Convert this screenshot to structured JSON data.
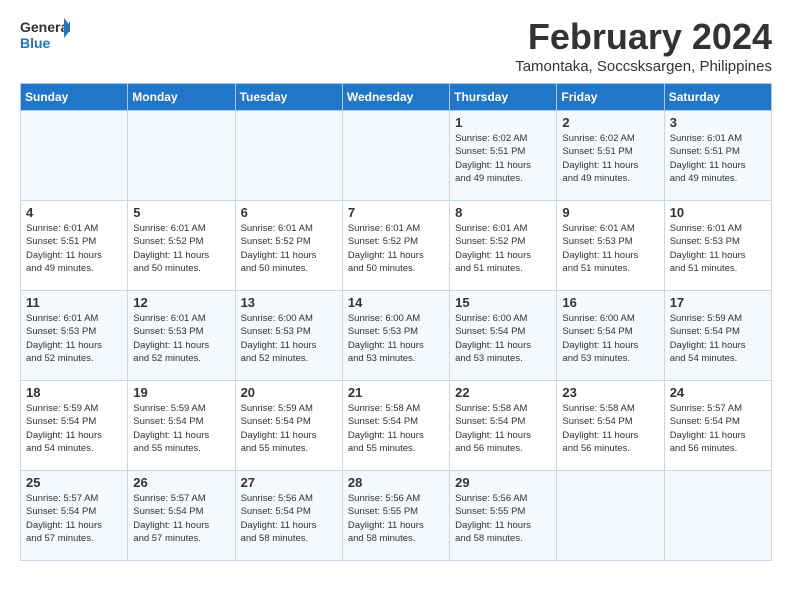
{
  "logo": {
    "text_general": "General",
    "text_blue": "Blue"
  },
  "header": {
    "month_year": "February 2024",
    "location": "Tamontaka, Soccsksargen, Philippines"
  },
  "days_of_week": [
    "Sunday",
    "Monday",
    "Tuesday",
    "Wednesday",
    "Thursday",
    "Friday",
    "Saturday"
  ],
  "weeks": [
    [
      {
        "day": "",
        "info": ""
      },
      {
        "day": "",
        "info": ""
      },
      {
        "day": "",
        "info": ""
      },
      {
        "day": "",
        "info": ""
      },
      {
        "day": "1",
        "info": "Sunrise: 6:02 AM\nSunset: 5:51 PM\nDaylight: 11 hours\nand 49 minutes."
      },
      {
        "day": "2",
        "info": "Sunrise: 6:02 AM\nSunset: 5:51 PM\nDaylight: 11 hours\nand 49 minutes."
      },
      {
        "day": "3",
        "info": "Sunrise: 6:01 AM\nSunset: 5:51 PM\nDaylight: 11 hours\nand 49 minutes."
      }
    ],
    [
      {
        "day": "4",
        "info": "Sunrise: 6:01 AM\nSunset: 5:51 PM\nDaylight: 11 hours\nand 49 minutes."
      },
      {
        "day": "5",
        "info": "Sunrise: 6:01 AM\nSunset: 5:52 PM\nDaylight: 11 hours\nand 50 minutes."
      },
      {
        "day": "6",
        "info": "Sunrise: 6:01 AM\nSunset: 5:52 PM\nDaylight: 11 hours\nand 50 minutes."
      },
      {
        "day": "7",
        "info": "Sunrise: 6:01 AM\nSunset: 5:52 PM\nDaylight: 11 hours\nand 50 minutes."
      },
      {
        "day": "8",
        "info": "Sunrise: 6:01 AM\nSunset: 5:52 PM\nDaylight: 11 hours\nand 51 minutes."
      },
      {
        "day": "9",
        "info": "Sunrise: 6:01 AM\nSunset: 5:53 PM\nDaylight: 11 hours\nand 51 minutes."
      },
      {
        "day": "10",
        "info": "Sunrise: 6:01 AM\nSunset: 5:53 PM\nDaylight: 11 hours\nand 51 minutes."
      }
    ],
    [
      {
        "day": "11",
        "info": "Sunrise: 6:01 AM\nSunset: 5:53 PM\nDaylight: 11 hours\nand 52 minutes."
      },
      {
        "day": "12",
        "info": "Sunrise: 6:01 AM\nSunset: 5:53 PM\nDaylight: 11 hours\nand 52 minutes."
      },
      {
        "day": "13",
        "info": "Sunrise: 6:00 AM\nSunset: 5:53 PM\nDaylight: 11 hours\nand 52 minutes."
      },
      {
        "day": "14",
        "info": "Sunrise: 6:00 AM\nSunset: 5:53 PM\nDaylight: 11 hours\nand 53 minutes."
      },
      {
        "day": "15",
        "info": "Sunrise: 6:00 AM\nSunset: 5:54 PM\nDaylight: 11 hours\nand 53 minutes."
      },
      {
        "day": "16",
        "info": "Sunrise: 6:00 AM\nSunset: 5:54 PM\nDaylight: 11 hours\nand 53 minutes."
      },
      {
        "day": "17",
        "info": "Sunrise: 5:59 AM\nSunset: 5:54 PM\nDaylight: 11 hours\nand 54 minutes."
      }
    ],
    [
      {
        "day": "18",
        "info": "Sunrise: 5:59 AM\nSunset: 5:54 PM\nDaylight: 11 hours\nand 54 minutes."
      },
      {
        "day": "19",
        "info": "Sunrise: 5:59 AM\nSunset: 5:54 PM\nDaylight: 11 hours\nand 55 minutes."
      },
      {
        "day": "20",
        "info": "Sunrise: 5:59 AM\nSunset: 5:54 PM\nDaylight: 11 hours\nand 55 minutes."
      },
      {
        "day": "21",
        "info": "Sunrise: 5:58 AM\nSunset: 5:54 PM\nDaylight: 11 hours\nand 55 minutes."
      },
      {
        "day": "22",
        "info": "Sunrise: 5:58 AM\nSunset: 5:54 PM\nDaylight: 11 hours\nand 56 minutes."
      },
      {
        "day": "23",
        "info": "Sunrise: 5:58 AM\nSunset: 5:54 PM\nDaylight: 11 hours\nand 56 minutes."
      },
      {
        "day": "24",
        "info": "Sunrise: 5:57 AM\nSunset: 5:54 PM\nDaylight: 11 hours\nand 56 minutes."
      }
    ],
    [
      {
        "day": "25",
        "info": "Sunrise: 5:57 AM\nSunset: 5:54 PM\nDaylight: 11 hours\nand 57 minutes."
      },
      {
        "day": "26",
        "info": "Sunrise: 5:57 AM\nSunset: 5:54 PM\nDaylight: 11 hours\nand 57 minutes."
      },
      {
        "day": "27",
        "info": "Sunrise: 5:56 AM\nSunset: 5:54 PM\nDaylight: 11 hours\nand 58 minutes."
      },
      {
        "day": "28",
        "info": "Sunrise: 5:56 AM\nSunset: 5:55 PM\nDaylight: 11 hours\nand 58 minutes."
      },
      {
        "day": "29",
        "info": "Sunrise: 5:56 AM\nSunset: 5:55 PM\nDaylight: 11 hours\nand 58 minutes."
      },
      {
        "day": "",
        "info": ""
      },
      {
        "day": "",
        "info": ""
      }
    ]
  ]
}
